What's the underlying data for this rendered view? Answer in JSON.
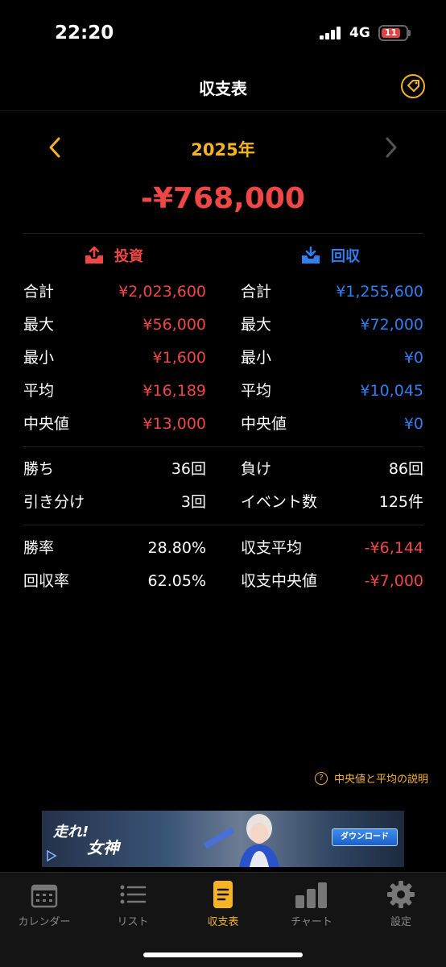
{
  "status_bar": {
    "time": "22:20",
    "network": "4G",
    "battery": "11"
  },
  "header": {
    "title": "収支表",
    "tag_icon": "tag-icon"
  },
  "year_nav": {
    "year": "2025年",
    "prev_icon": "chevron-left-icon",
    "next_icon": "chevron-right-icon"
  },
  "balance_total": "-¥768,000",
  "investment": {
    "label": "投資",
    "rows": [
      {
        "label": "合計",
        "value": "¥2,023,600"
      },
      {
        "label": "最大",
        "value": "¥56,000"
      },
      {
        "label": "最小",
        "value": "¥1,600"
      },
      {
        "label": "平均",
        "value": "¥16,189"
      },
      {
        "label": "中央値",
        "value": "¥13,000"
      }
    ]
  },
  "recovery": {
    "label": "回収",
    "rows": [
      {
        "label": "合計",
        "value": "¥1,255,600"
      },
      {
        "label": "最大",
        "value": "¥72,000"
      },
      {
        "label": "最小",
        "value": "¥0"
      },
      {
        "label": "平均",
        "value": "¥10,045"
      },
      {
        "label": "中央値",
        "value": "¥0"
      }
    ]
  },
  "results": {
    "wins": {
      "label": "勝ち",
      "value": "36回"
    },
    "losses": {
      "label": "負け",
      "value": "86回"
    },
    "draws": {
      "label": "引き分け",
      "value": "3回"
    },
    "events": {
      "label": "イベント数",
      "value": "125件"
    }
  },
  "rates": {
    "win_rate": {
      "label": "勝率",
      "value": "28.80%"
    },
    "balance_avg": {
      "label": "収支平均",
      "value": "-¥6,144"
    },
    "recovery_rate": {
      "label": "回収率",
      "value": "62.05%"
    },
    "balance_median": {
      "label": "収支中央値",
      "value": "-¥7,000"
    }
  },
  "help_link": "中央値と平均の説明",
  "ad": {
    "title_line1": "走れ!",
    "title_line2": "女神",
    "button": "ダウンロード"
  },
  "tabs": [
    {
      "label": "カレンダー",
      "icon": "calendar-icon"
    },
    {
      "label": "リスト",
      "icon": "list-icon"
    },
    {
      "label": "収支表",
      "icon": "document-icon",
      "active": true
    },
    {
      "label": "チャート",
      "icon": "bar-chart-icon"
    },
    {
      "label": "設定",
      "icon": "gear-icon"
    }
  ],
  "colors": {
    "accent": "#f6b324",
    "negative": "#ef4646",
    "positive": "#2f7ff0"
  }
}
